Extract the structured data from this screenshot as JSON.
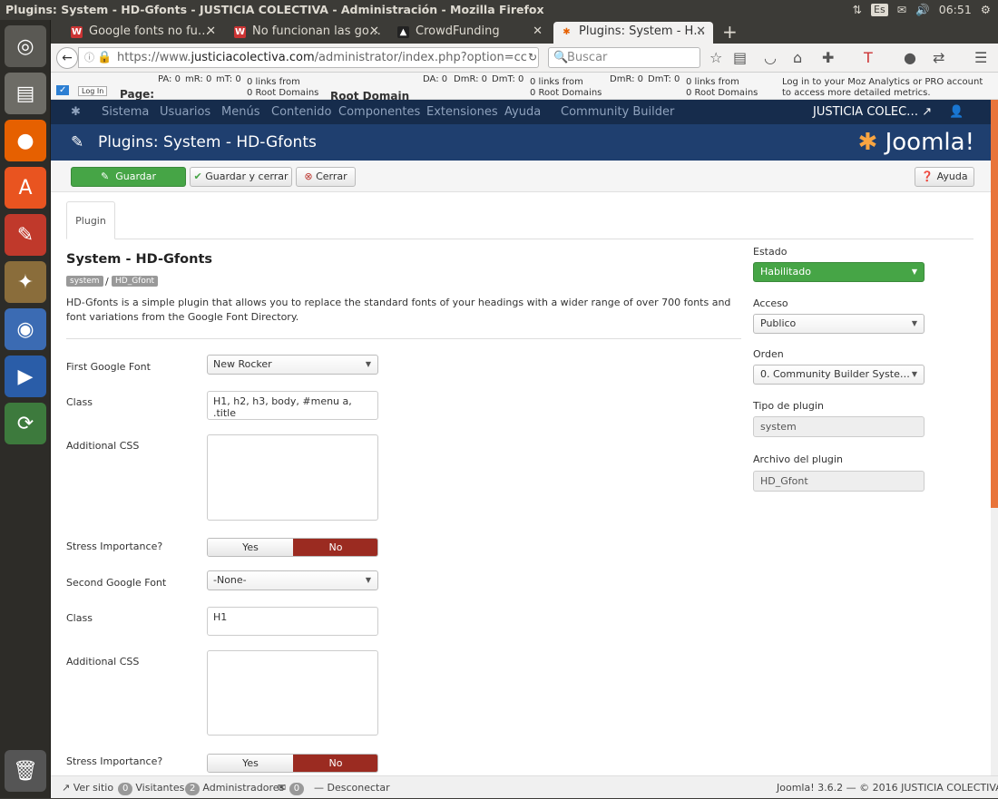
{
  "window": {
    "title": "Plugins: System - HD-Gfonts - JUSTICIA COLECTIVA - Administración - Mozilla Firefox",
    "lang": "Es",
    "clock": "06:51"
  },
  "browser": {
    "tabs": [
      {
        "label": "Google fonts no fu…",
        "icon": "W"
      },
      {
        "label": "No funcionan las go…",
        "icon": "W"
      },
      {
        "label": "CrowdFunding",
        "icon": "▲"
      },
      {
        "label": "Plugins: System - H…",
        "icon": "✱"
      }
    ],
    "url_prefix": "https://www.",
    "url_domain": "justiciacolectiva.com",
    "url_path": "/administrator/index.php?option=cc",
    "search_placeholder": "Buscar"
  },
  "moz": {
    "log_in": "Log In",
    "page": "Page:",
    "pa": "PA:",
    "pa_v": "0",
    "mr": "mR:",
    "mr_v": "0",
    "mt": "mT:",
    "mt_v": "0",
    "links1": "0 links from",
    "rootdom1": "0 Root Domains",
    "root_domain": "Root Domain",
    "da": "DA:",
    "da_v": "0",
    "dmr": "DmR:",
    "dmr_v": "0",
    "dmt": "DmT:",
    "dmt_v": "0",
    "links2": "0 links from",
    "rootdom2": "0 Root Domains",
    "dmr2": "DmR:",
    "dmr2_v": "0",
    "dmt2": "DmT:",
    "dmt2_v": "0",
    "links3": "0 links from",
    "rootdom3": "0 Root Domains",
    "pro1": "Log in to your Moz Analytics or PRO account",
    "pro2": "to access more detailed metrics."
  },
  "joomla_nav": {
    "items": [
      "Sistema",
      "Usuarios",
      "Menús",
      "Contenido",
      "Componentes",
      "Extensiones",
      "Ayuda",
      "Community Builder"
    ],
    "site": "JUSTICIA COLEC…"
  },
  "header": {
    "title": "Plugins: System - HD-Gfonts",
    "logo": "Joomla!"
  },
  "toolbar": {
    "save": "Guardar",
    "save_close": "Guardar y cerrar",
    "close": "Cerrar",
    "help": "Ayuda"
  },
  "content": {
    "tab": "Plugin",
    "title": "System - HD-Gfonts",
    "label_folder": "system",
    "label_sep": "/",
    "label_element": "HD_Gfont",
    "description": "HD-Gfonts is a simple plugin that allows you to replace the standard fonts of your headings with a wider range of over 700 fonts and font variations from the Google Font Directory.",
    "fields": {
      "font1_label": "First Google Font",
      "font1_value": "New Rocker",
      "class1_label": "Class",
      "class1_value": "H1, h2, h3, body, #menu a, .title",
      "css1_label": "Additional CSS",
      "stress1_label": "Stress Importance?",
      "font2_label": "Second Google Font",
      "font2_value": "-None-",
      "class2_label": "Class",
      "class2_value": "H1",
      "css2_label": "Additional CSS",
      "stress2_label": "Stress Importance?",
      "yes": "Yes",
      "no": "No"
    }
  },
  "sidebar": {
    "estado_label": "Estado",
    "estado_value": "Habilitado",
    "acceso_label": "Acceso",
    "acceso_value": "Publico",
    "orden_label": "Orden",
    "orden_value": "0. Community Builder Syste…",
    "tipo_label": "Tipo de plugin",
    "tipo_value": "system",
    "archivo_label": "Archivo del plugin",
    "archivo_value": "HD_Gfont"
  },
  "status": {
    "ver_sitio": "Ver sitio",
    "visitors_count": "0",
    "visitors": "Visitantes",
    "admins_count": "2",
    "admins": "Administradores",
    "msg_count": "0",
    "logout": "Desconectar",
    "version": "Joomla! 3.6.2 — © 2016 JUSTICIA COLECTIVA"
  },
  "colors": {
    "joomla_nav": "#162c4c",
    "joomla_header": "#1f3f6f",
    "success": "#46a546",
    "danger": "#9b2b21"
  }
}
